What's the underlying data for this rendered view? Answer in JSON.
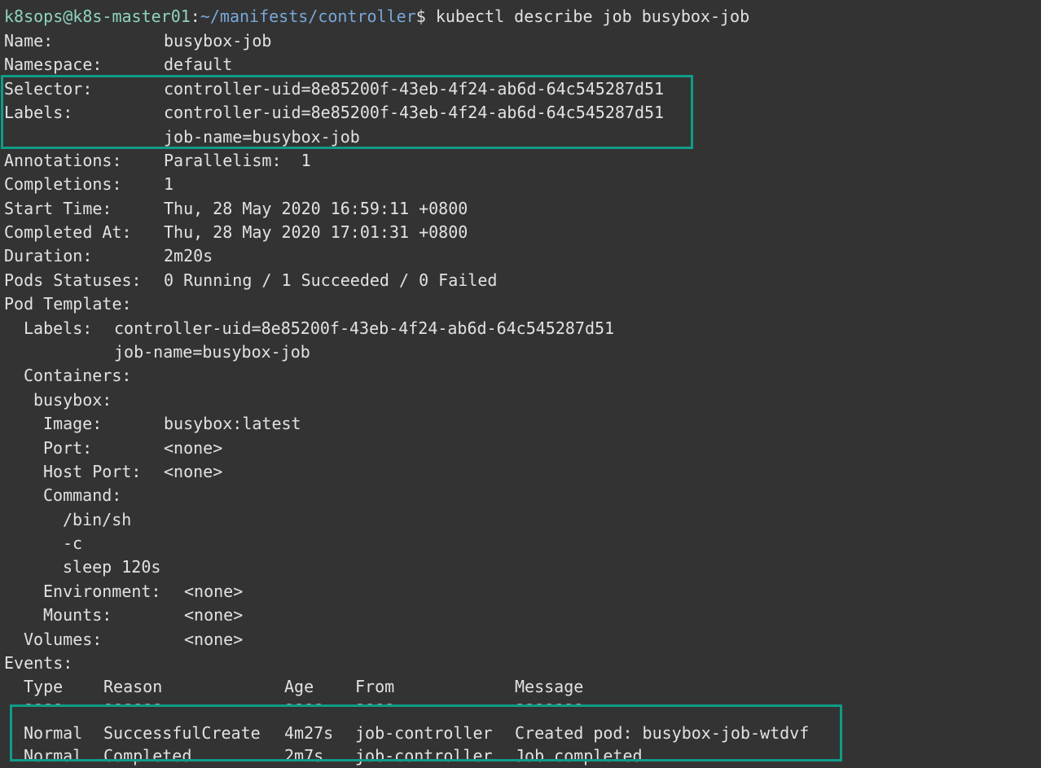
{
  "prompt": {
    "user_host": "k8sops@k8s-master01",
    "separator": ":",
    "path": "~/manifests/controller",
    "symbol": "$ ",
    "command": "kubectl describe job busybox-job"
  },
  "fields": [
    {
      "key": "Name:",
      "value": "busybox-job"
    },
    {
      "key": "Namespace:",
      "value": "default"
    },
    {
      "key": "Selector:",
      "value": "controller-uid=8e85200f-43eb-4f24-ab6d-64c545287d51"
    },
    {
      "key": "Labels:",
      "value": "controller-uid=8e85200f-43eb-4f24-ab6d-64c545287d51"
    },
    {
      "key": "",
      "value": "job-name=busybox-job"
    },
    {
      "key": "Annotations:",
      "value": "Parallelism:  1"
    },
    {
      "key": "Completions:",
      "value": "1"
    },
    {
      "key": "Start Time:",
      "value": "Thu, 28 May 2020 16:59:11 +0800"
    },
    {
      "key": "Completed At:",
      "value": "Thu, 28 May 2020 17:01:31 +0800"
    },
    {
      "key": "Duration:",
      "value": "2m20s"
    },
    {
      "key": "Pods Statuses:",
      "value": "0 Running / 1 Succeeded / 0 Failed"
    }
  ],
  "pod_template": {
    "heading": "Pod Template:",
    "labels_key": "Labels:",
    "labels_value_1": "controller-uid=8e85200f-43eb-4f24-ab6d-64c545287d51",
    "labels_value_2": "job-name=busybox-job",
    "containers_heading": "Containers:",
    "container_name": "busybox:",
    "image_key": "Image:",
    "image_value": "busybox:latest",
    "port_key": "Port:",
    "port_value": "<none>",
    "host_port_key": "Host Port:",
    "host_port_value": "<none>",
    "command_heading": "Command:",
    "command_args": [
      "/bin/sh",
      "-c",
      "sleep 120s"
    ],
    "environment_key": "Environment:",
    "environment_value": "<none>",
    "mounts_key": "Mounts:",
    "mounts_value": "<none>",
    "volumes_key": "Volumes:",
    "volumes_value": "<none>"
  },
  "events": {
    "heading": "Events:",
    "columns": [
      "Type",
      "Reason",
      "Age",
      "From",
      "Message"
    ],
    "underlines": [
      "----",
      "------",
      "----",
      "----",
      "-------"
    ],
    "rows": [
      [
        "Normal",
        "SuccessfulCreate",
        "4m27s",
        "job-controller",
        "Created pod: busybox-job-wtdvf"
      ],
      [
        "Normal",
        "Completed",
        "2m7s",
        "job-controller",
        "Job completed"
      ]
    ]
  },
  "colors": {
    "background": "#333333",
    "text": "#e2e2e2",
    "user_host": "#8fd4c1",
    "path": "#78a8d8",
    "highlight_border": "#0f9c88"
  }
}
